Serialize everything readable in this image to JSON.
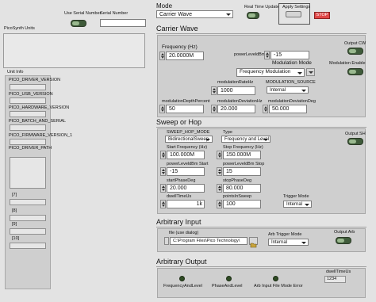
{
  "left": {
    "use_serial_label": "Use Serial Number",
    "serial_label": "Serial Number",
    "serial_value": "",
    "units_label": "PicoSynth Units",
    "unit_info_label": "Unit Info",
    "unit_info_items": [
      "PICO_DRIVER_VERSION",
      "PICO_USB_VERSION",
      "PICO_HARDWARE_VERSION",
      "PICO_BATCH_AND_SERIAL",
      "PICO_FIRMWARE_VERSION_1",
      "PICO_DRIVER_PATH"
    ],
    "index_labels": [
      "[7]",
      "[8]",
      "[9]",
      "[10]"
    ]
  },
  "top": {
    "mode_label": "Mode",
    "mode_value": "Carrier Wave",
    "realtime_label": "Real Time Update",
    "apply_label": "Apply Settings",
    "stop_label": "STOP"
  },
  "carrier": {
    "title": "Carrier Wave",
    "freq_label": "Frequency (Hz)",
    "freq_value": "20.0000M",
    "power_label": "powerLeveldBm",
    "power_value": "-15",
    "modmode_label": "Modulation Mode",
    "modmode_value": "Frequency Modulation",
    "modrate_label": "modulationRateHz",
    "modrate_value": "1000",
    "modsource_label": "MODULATION_SOURCE",
    "modsource_value": "Internal",
    "depth_label": "modulationDepthPercent",
    "depth_value": "50",
    "deviation_label": "modulationDeviationHz",
    "deviation_value": "20.000",
    "devdeg_label": "modulationDeviationDeg",
    "devdeg_value": "50.000",
    "output_cw_label": "Output CW",
    "mod_enable_label": "Modulation Enable"
  },
  "sweep": {
    "title": "Sweep or Hop",
    "mode_label": "SWEEP_HOP_MODE",
    "mode_value": "BidirectionalSweep",
    "type_label": "Type",
    "type_value": "Frequency and Level",
    "start_label": "Start Frequency (Hz)",
    "start_value": "100.000M",
    "stop_label": "Stop Frequency (Hz)",
    "stop_value": "150.000M",
    "pstart_label": "powerLeveldBm Start",
    "pstart_value": "-15",
    "pstop_label": "powerLeveldBm Stop",
    "pstop_value": "15",
    "sphase_label": "startPhaseDeg",
    "sphase_value": "20.000",
    "ephase_label": "stopPhaseDeg",
    "ephase_value": "80.000",
    "dwell_label": "dwellTimeUs",
    "dwell_value": "1k",
    "points_label": "pointsInSweep",
    "points_value": "100",
    "trigger_label": "Trigger Mode",
    "trigger_value": "Internal",
    "output_label": "Output SH"
  },
  "arb_input": {
    "title": "Arbitrary Input",
    "file_label": "file (use dialog)",
    "file_value": "C:\\Program Files\\Pico Technology\\",
    "trigger_label": "Arb Trigger Mode",
    "trigger_value": "Internal",
    "output_label": "Output  Arb"
  },
  "arb_output": {
    "title": "Arbitrary Output",
    "freq_level_label": "FrequencyAndLevel",
    "phase_level_label": "PhaseAndLevel",
    "error_label": "Arb Input File Mode Error",
    "dwell_label": "dwellTimeUs",
    "dwell_value": "1234"
  },
  "colors": {
    "background": "#e3e3e3",
    "panel": "#cfcfcf",
    "stop_button": "#e04848",
    "led_off": "#2f4b24"
  }
}
